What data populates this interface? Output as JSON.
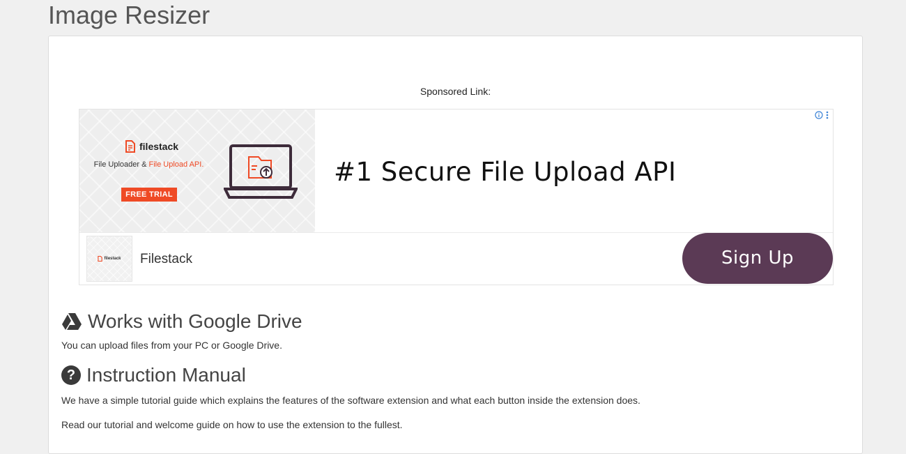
{
  "page": {
    "title": "Image Resizer"
  },
  "sponsored": {
    "label": "Sponsored Link:",
    "ad": {
      "brand": "filestack",
      "subtitle_prefix": "File Uploader & ",
      "subtitle_accent": "File Upload API.",
      "trial_label": "FREE TRIAL",
      "headline": "#1 Secure File Upload API",
      "advertiser": "Filestack",
      "thumb_brand": "filestack",
      "cta_label": "Sign Up",
      "cta_color": "#5b3a55",
      "accent_color": "#ef4a25",
      "icons": [
        "info-icon",
        "more-options-icon",
        "laptop-upload-icon"
      ]
    }
  },
  "sections": {
    "drive": {
      "icon": "google-drive-icon",
      "heading": "Works with Google Drive",
      "text": "You can upload files from your PC or Google Drive."
    },
    "manual": {
      "icon": "question-icon",
      "heading": "Instruction Manual",
      "text1": "We have a simple tutorial guide which explains the features of the software extension and what each button inside the extension does.",
      "text2": "Read our tutorial and welcome guide on how to use the extension to the fullest."
    }
  }
}
